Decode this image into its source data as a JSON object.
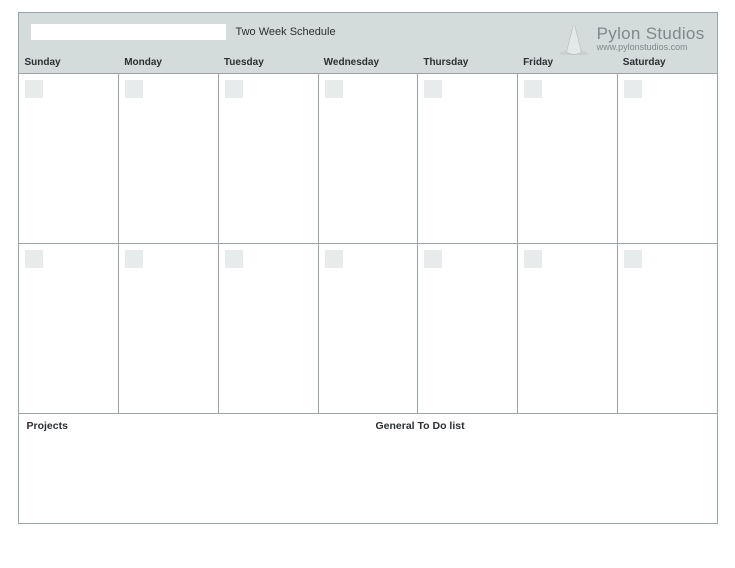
{
  "header": {
    "title_input_value": "",
    "schedule_label": "Two Week Schedule"
  },
  "brand": {
    "name": "Pylon Studios",
    "url": "www.pylonstudios.com"
  },
  "days": [
    "Sunday",
    "Monday",
    "Tuesday",
    "Wednesday",
    "Thursday",
    "Friday",
    "Saturday"
  ],
  "footer": {
    "projects_label": "Projects",
    "todo_label": "General To Do list"
  }
}
